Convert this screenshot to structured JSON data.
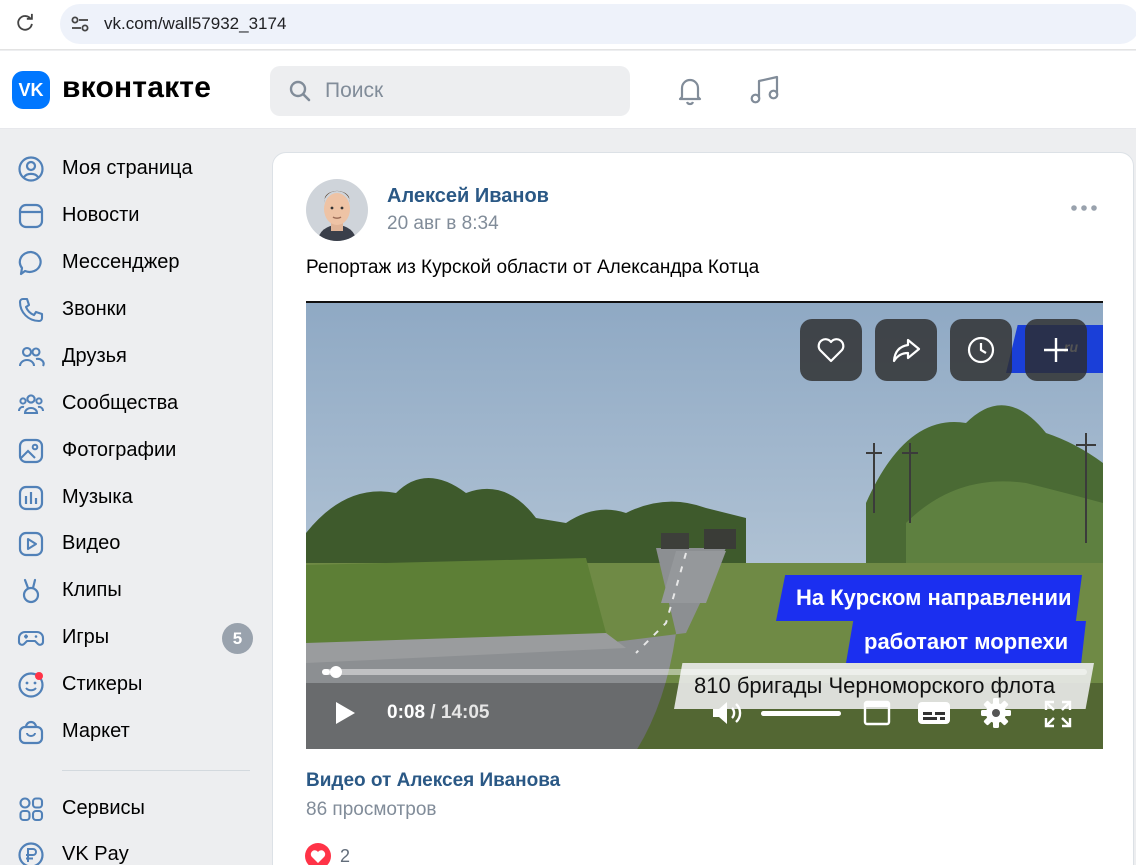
{
  "browser": {
    "url": "vk.com/wall57932_3174"
  },
  "header": {
    "logo_text": "VK",
    "wordmark": "вконтакте",
    "search_placeholder": "Поиск",
    "icons": [
      "bell-icon",
      "music-note-icon"
    ]
  },
  "sidebar": {
    "items": [
      {
        "label": "Моя страница",
        "icon": "user-circle-icon"
      },
      {
        "label": "Новости",
        "icon": "news-icon"
      },
      {
        "label": "Мессенджер",
        "icon": "chat-bubble-icon"
      },
      {
        "label": "Звонки",
        "icon": "phone-icon"
      },
      {
        "label": "Друзья",
        "icon": "friends-icon"
      },
      {
        "label": "Сообщества",
        "icon": "communities-icon"
      },
      {
        "label": "Фотографии",
        "icon": "photo-icon"
      },
      {
        "label": "Музыка",
        "icon": "music-bars-icon"
      },
      {
        "label": "Видео",
        "icon": "video-play-icon"
      },
      {
        "label": "Клипы",
        "icon": "clips-icon"
      },
      {
        "label": "Игры",
        "icon": "gamepad-icon",
        "badge": "5"
      },
      {
        "label": "Стикеры",
        "icon": "sticker-icon"
      },
      {
        "label": "Маркет",
        "icon": "shopping-bag-icon"
      },
      {
        "label": "Сервисы",
        "icon": "services-grid-icon"
      },
      {
        "label": "VK Pay",
        "icon": "vk-pay-icon"
      }
    ]
  },
  "post": {
    "author": "Алексей Иванов",
    "date": "20 авг в 8:34",
    "text": "Репортаж из Курской области от Александра Котца",
    "video": {
      "current_time": "0:08",
      "separator": " / ",
      "duration": "14:05",
      "progress": 0.01,
      "volume": 1.0,
      "channel_logo": "ru",
      "caption_line1": "На Курском направлении",
      "caption_line2": "работают морпехи",
      "caption_line3": "810 бригады Черноморского флота",
      "overlay_buttons": [
        "heart-icon",
        "share-icon",
        "watch-later-icon",
        "add-icon"
      ]
    },
    "video_title": "Видео от Алексея Иванова",
    "views": "86 просмотров",
    "likes": "2"
  },
  "colors": {
    "vk_blue": "#0077ff",
    "link": "#2a5885",
    "secondary_text": "#818c99",
    "caption_blue": "#1b2ff0",
    "like_red": "#ff3347"
  }
}
